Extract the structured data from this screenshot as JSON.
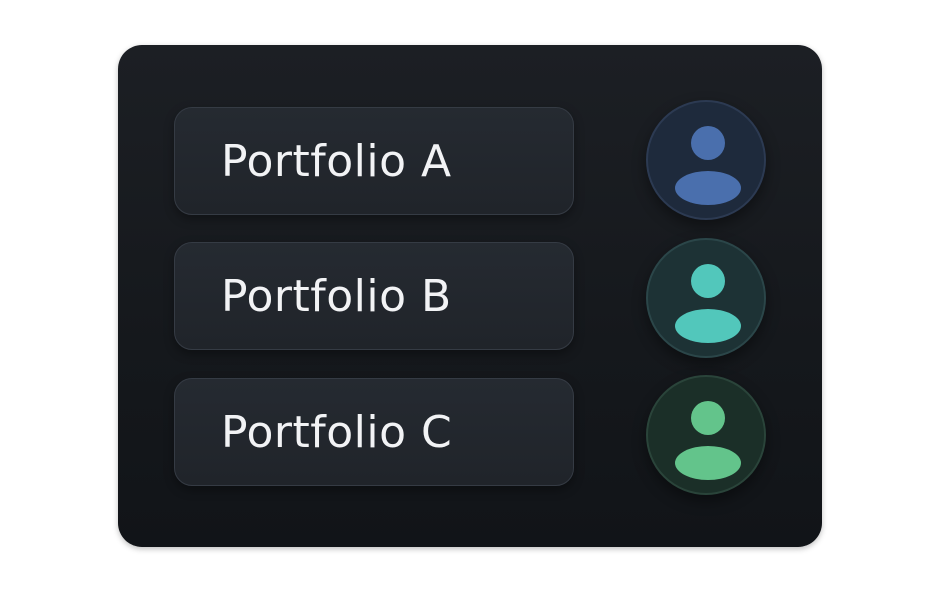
{
  "portfolios": [
    {
      "label": "Portfolio A",
      "avatar_icon": "user-icon",
      "avatar_bg": "#1e2a3c",
      "avatar_border": "#2c3a52",
      "avatar_color": "#4a6fad"
    },
    {
      "label": "Portfolio B",
      "avatar_icon": "user-icon",
      "avatar_bg": "#1d3235",
      "avatar_border": "#2b4649",
      "avatar_color": "#52c7bb"
    },
    {
      "label": "Portfolio C",
      "avatar_icon": "user-icon",
      "avatar_bg": "#1b2f28",
      "avatar_border": "#2a443a",
      "avatar_color": "#63c48b"
    }
  ]
}
